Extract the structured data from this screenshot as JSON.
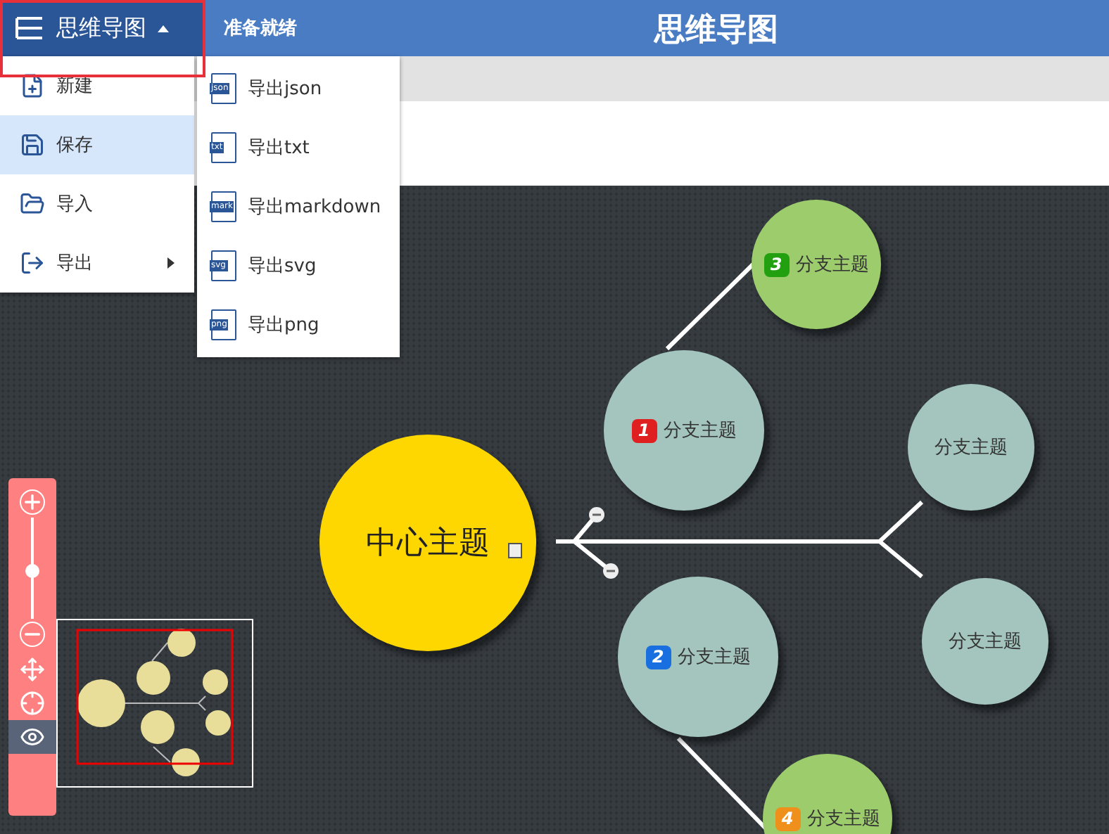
{
  "header": {
    "menu_label": "思维导图",
    "menu_open": true,
    "status": "准备就绪",
    "title": "思维导图"
  },
  "menu": [
    {
      "kind": "new",
      "label": "新建",
      "selected": false,
      "submenu": false
    },
    {
      "kind": "save",
      "label": "保存",
      "selected": true,
      "submenu": false
    },
    {
      "kind": "import",
      "label": "导入",
      "selected": false,
      "submenu": false
    },
    {
      "kind": "export",
      "label": "导出",
      "selected": false,
      "submenu": true
    }
  ],
  "export_menu": [
    {
      "tag": "json",
      "label": "导出json"
    },
    {
      "tag": "txt",
      "label": "导出txt"
    },
    {
      "tag": "mark",
      "label": "导出markdown"
    },
    {
      "tag": "svg",
      "label": "导出svg"
    },
    {
      "tag": "png",
      "label": "导出png"
    }
  ],
  "mindmap": {
    "root": {
      "label": "中心主题",
      "has_note": true
    },
    "branches": [
      {
        "label": "分支主题",
        "badge": "1",
        "color": "#e02020",
        "kind": "large"
      },
      {
        "label": "分支主题",
        "badge": "2",
        "color": "#1a6fe0",
        "kind": "large"
      },
      {
        "label": "分支主题",
        "badge": "3",
        "color": "#22a010",
        "kind": "small-green"
      },
      {
        "label": "分支主题",
        "badge": "4",
        "color": "#f0901c",
        "kind": "small-green"
      },
      {
        "label": "分支主题",
        "kind": "small"
      },
      {
        "label": "分支主题",
        "kind": "small"
      }
    ]
  },
  "zoom": {
    "level": 0.47
  },
  "tools": [
    {
      "kind": "move",
      "selected": false
    },
    {
      "kind": "locate",
      "selected": false
    },
    {
      "kind": "overview",
      "selected": true
    }
  ]
}
